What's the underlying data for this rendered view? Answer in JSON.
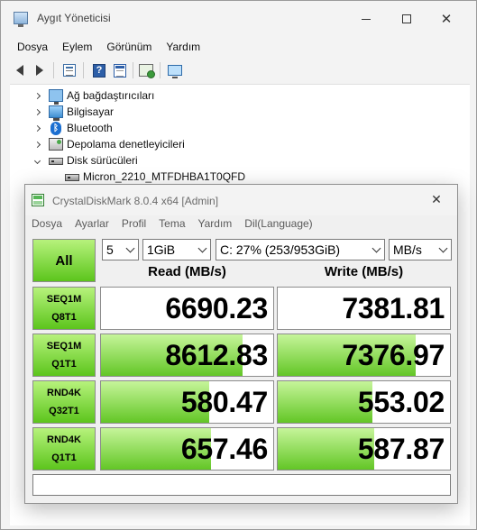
{
  "device_manager": {
    "title": "Aygıt Yöneticisi",
    "menu": [
      "Dosya",
      "Eylem",
      "Görünüm",
      "Yardım"
    ],
    "toolbar_icons": [
      "back-icon",
      "forward-icon",
      "properties-sheet-icon",
      "help-icon",
      "properties-icon",
      "scan-hardware-icon",
      "monitor-icon"
    ],
    "tree": [
      {
        "label": "Ağ bağdaştırıcıları",
        "icon": "network-adapter-icon",
        "expanded": false
      },
      {
        "label": "Bilgisayar",
        "icon": "computer-icon",
        "expanded": false
      },
      {
        "label": "Bluetooth",
        "icon": "bluetooth-icon",
        "expanded": false
      },
      {
        "label": "Depolama denetleyicileri",
        "icon": "storage-controller-icon",
        "expanded": false
      },
      {
        "label": "Disk sürücüleri",
        "icon": "disk-drive-icon",
        "expanded": true
      },
      {
        "label": "Micron_2210_MTFDHBA1T0QFD",
        "icon": "disk-drive-icon",
        "child": true
      }
    ],
    "window_controls": {
      "minimize": "minimize",
      "maximize": "maximize",
      "close": "✕"
    }
  },
  "cdm": {
    "title": "CrystalDiskMark 8.0.4 x64 [Admin]",
    "menu": [
      "Dosya",
      "Ayarlar",
      "Profil",
      "Tema",
      "Yardım",
      "Dil(Language)"
    ],
    "close_glyph": "✕",
    "all_label": "All",
    "count": "5",
    "size": "1GiB",
    "drive": "C: 27% (253/953GiB)",
    "unit": "MB/s",
    "read_header": "Read (MB/s)",
    "write_header": "Write (MB/s)",
    "tests": [
      {
        "line1": "SEQ1M",
        "line2": "Q8T1",
        "read": "6690.23",
        "write": "7381.81",
        "read_fill": 0.0,
        "write_fill": 0.0
      },
      {
        "line1": "SEQ1M",
        "line2": "Q1T1",
        "read": "8612.83",
        "write": "7376.97",
        "read_fill": 0.82,
        "write_fill": 0.8
      },
      {
        "line1": "RND4K",
        "line2": "Q32T1",
        "read": "580.47",
        "write": "553.02",
        "read_fill": 0.63,
        "write_fill": 0.55
      },
      {
        "line1": "RND4K",
        "line2": "Q1T1",
        "read": "657.46",
        "write": "587.87",
        "read_fill": 0.64,
        "write_fill": 0.56
      }
    ],
    "comment": ""
  },
  "colors": {
    "accent_green": "#5cc51c",
    "bar_green_light": "#c6f59a",
    "window_bg": "#f0f0f0"
  }
}
